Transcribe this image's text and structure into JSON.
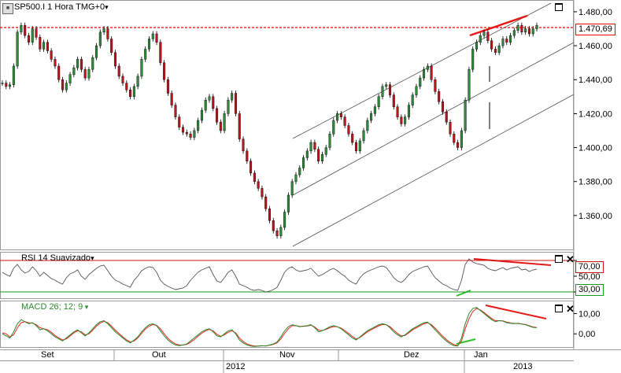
{
  "header": {
    "symbol": "SP500.I",
    "timeframe": "1 Hora",
    "timezone": "TMG+0",
    "dropdown_glyph": "▾",
    "last_price": "1.470,69"
  },
  "rsi_panel": {
    "title": "RSI 14 Suavizado",
    "upper_level": "70,00",
    "middle_level": "50,00",
    "lower_level": "30,00"
  },
  "macd_panel": {
    "title": "MACD 26; 12; 9"
  },
  "colors": {
    "price_up": "#2f8a3a",
    "price_down": "#c0131b",
    "resistance": "#ff0000",
    "trendline": "#e61919",
    "macd_line": "#2b8a2b",
    "signal_line": "#e6281e",
    "rsi_upper": "#d01010",
    "rsi_lower": "#1a9a1a"
  },
  "chart_data": [
    {
      "type": "candlestick",
      "title": "SP500.I 1 Hora TMG+0",
      "y_ticks": [
        "1.480,00",
        "1.460,00",
        "1.440,00",
        "1.420,00",
        "1.400,00",
        "1.380,00",
        "1.360,00"
      ],
      "ylim": [
        1340,
        1486
      ],
      "x_ticks": [
        "Set",
        "Out",
        "Nov",
        "Dez",
        "Jan"
      ],
      "x_years": [
        "2012",
        "2013"
      ],
      "resistance_level": 1470.69,
      "series": [
        {
          "values": [
            1438,
            1436,
            1437,
            1448,
            1468,
            1472,
            1466,
            1462,
            1470,
            1465,
            1458,
            1462,
            1457,
            1452,
            1448,
            1440,
            1434,
            1438,
            1443,
            1447,
            1452,
            1446,
            1441,
            1446,
            1453,
            1460,
            1468,
            1470,
            1464,
            1456,
            1448,
            1442,
            1438,
            1434,
            1430,
            1436,
            1442,
            1452,
            1458,
            1464,
            1467,
            1462,
            1450,
            1440,
            1432,
            1425,
            1418,
            1412,
            1409,
            1408,
            1406,
            1410,
            1416,
            1422,
            1428,
            1430,
            1423,
            1415,
            1410,
            1420,
            1428,
            1432,
            1420,
            1405,
            1398,
            1392,
            1385,
            1380,
            1376,
            1371,
            1364,
            1357,
            1351,
            1348,
            1353,
            1362,
            1372,
            1380,
            1384,
            1388,
            1394,
            1398,
            1403,
            1399,
            1392,
            1396,
            1400,
            1408,
            1416,
            1420,
            1418,
            1413,
            1408,
            1403,
            1398,
            1404,
            1410,
            1416,
            1420,
            1424,
            1430,
            1436,
            1437,
            1431,
            1424,
            1418,
            1414,
            1418,
            1425,
            1431,
            1436,
            1441,
            1446,
            1448,
            1440,
            1433,
            1427,
            1421,
            1415,
            1408,
            1403,
            1400,
            1410,
            1428,
            1446,
            1458,
            1462,
            1466,
            1468,
            1463,
            1458,
            1456,
            1460,
            1464,
            1462,
            1466,
            1469,
            1472,
            1468,
            1470,
            1467,
            1470,
            1472
          ]
        }
      ]
    },
    {
      "type": "line",
      "title": "RSI 14 Suavizado",
      "ylim": [
        22,
        80
      ],
      "y_ticks": [
        "70,00",
        "50,00",
        "30,00"
      ],
      "levels": [
        70,
        50,
        30
      ],
      "series": [
        {
          "values": [
            55,
            52,
            50,
            60,
            65,
            58,
            54,
            56,
            62,
            57,
            50,
            55,
            51,
            47,
            45,
            42,
            40,
            48,
            53,
            55,
            58,
            50,
            46,
            52,
            56,
            60,
            63,
            64,
            57,
            50,
            45,
            43,
            40,
            38,
            36,
            45,
            50,
            57,
            60,
            62,
            61,
            55,
            45,
            40,
            37,
            35,
            33,
            34,
            35,
            38,
            45,
            50,
            55,
            58,
            60,
            62,
            52,
            44,
            42,
            48,
            55,
            58,
            50,
            40,
            38,
            36,
            33,
            32,
            33,
            32,
            30,
            31,
            33,
            36,
            45,
            55,
            60,
            62,
            58,
            56,
            57,
            58,
            60,
            55,
            50,
            52,
            55,
            58,
            60,
            57,
            53,
            50,
            45,
            42,
            40,
            48,
            53,
            56,
            58,
            60,
            62,
            63,
            61,
            55,
            48,
            44,
            42,
            46,
            52,
            56,
            58,
            60,
            62,
            63,
            55,
            48,
            44,
            40,
            38,
            35,
            33,
            32,
            45,
            65,
            72,
            68,
            66,
            65,
            64,
            60,
            58,
            57,
            59,
            61,
            58,
            60,
            61,
            62,
            58,
            59,
            56,
            58,
            59
          ]
        }
      ]
    },
    {
      "type": "line",
      "title": "MACD 26; 12; 9",
      "ylim": [
        -6.5,
        16
      ],
      "y_ticks": [
        "10,00",
        "0,00"
      ],
      "series": [
        {
          "values": [
            0,
            -1,
            -2,
            1,
            5,
            7,
            6,
            5,
            5.5,
            4,
            2,
            2.5,
            1.5,
            0,
            -1.5,
            -2.5,
            -3.5,
            -2,
            -0.5,
            1,
            2,
            0.5,
            -1,
            0.5,
            2.5,
            4.5,
            6,
            6.5,
            5,
            3,
            1,
            -0.5,
            -2,
            -3.5,
            -4.5,
            -3,
            -1.5,
            1,
            3,
            4.5,
            5,
            4,
            1.5,
            -1,
            -3,
            -4.5,
            -5.5,
            -5.8,
            -5.5,
            -5,
            -3.5,
            -2,
            -0.5,
            1,
            2,
            2.5,
            1,
            -1,
            -1.5,
            0,
            1.5,
            2,
            0,
            -3,
            -4.5,
            -5.5,
            -6,
            -6.2,
            -6,
            -5.8,
            -6,
            -5.5,
            -5,
            -4,
            -1.5,
            1.5,
            3.5,
            4.5,
            4,
            3.5,
            3.8,
            4,
            4.5,
            3,
            1,
            1.5,
            2.5,
            3.5,
            4,
            3.5,
            2.5,
            1,
            -0.5,
            -2,
            -3,
            -1.5,
            0,
            1.5,
            2.5,
            3.5,
            4.5,
            5,
            4.5,
            3,
            1,
            -0.5,
            -1.5,
            -0.5,
            1,
            2.5,
            3.5,
            4.5,
            5.5,
            5.8,
            4,
            2,
            0,
            -2,
            -3.5,
            -5,
            -5.8,
            -6,
            -2,
            5,
            10,
            12.5,
            13,
            11.5,
            10,
            8.5,
            7,
            6,
            6.5,
            6.3,
            5.5,
            5.2,
            5,
            5.2,
            4.8,
            4.5,
            3.8,
            3.2,
            3
          ]
        },
        {
          "values": [
            0.5,
            0,
            -1.5,
            -0.5,
            3,
            5.5,
            6,
            5.5,
            5.3,
            4.5,
            3,
            2.5,
            2,
            0.8,
            -0.8,
            -2,
            -3,
            -2.5,
            -1,
            0.5,
            1.5,
            1,
            -0.5,
            0,
            1.8,
            3.8,
            5.3,
            6.2,
            5.5,
            3.8,
            1.8,
            0.2,
            -1.5,
            -3,
            -4,
            -3.5,
            -2,
            0.2,
            2.3,
            3.8,
            4.6,
            4.2,
            2.5,
            0,
            -2.2,
            -3.8,
            -5,
            -5.5,
            -5.5,
            -5.2,
            -4.2,
            -2.8,
            -1.2,
            0.3,
            1.5,
            2.2,
            1.5,
            -0.2,
            -1.2,
            -0.5,
            0.8,
            1.5,
            0.5,
            -2,
            -3.8,
            -5,
            -5.6,
            -6,
            -6,
            -5.9,
            -5.9,
            -5.6,
            -5.2,
            -4.4,
            -2.5,
            0.2,
            2.5,
            4,
            4,
            3.7,
            3.7,
            3.9,
            4.3,
            3.4,
            1.8,
            1.6,
            2.2,
            3,
            3.6,
            3.5,
            2.8,
            1.6,
            0.2,
            -1.3,
            -2.5,
            -1.8,
            -0.5,
            1,
            2,
            3,
            4,
            4.6,
            4.5,
            3.5,
            1.8,
            0.2,
            -1,
            -0.8,
            0.5,
            2,
            3,
            4,
            5,
            5.5,
            4.5,
            2.8,
            0.8,
            -1.2,
            -2.8,
            -4.3,
            -5.3,
            -5.8,
            -3.5,
            2.5,
            7.5,
            11,
            12.5,
            11.8,
            10.5,
            9,
            7.6,
            6.5,
            6.5,
            6.4,
            5.8,
            5.4,
            5.1,
            5.1,
            4.9,
            4.6,
            4,
            3.4,
            3.1
          ]
        }
      ]
    }
  ]
}
